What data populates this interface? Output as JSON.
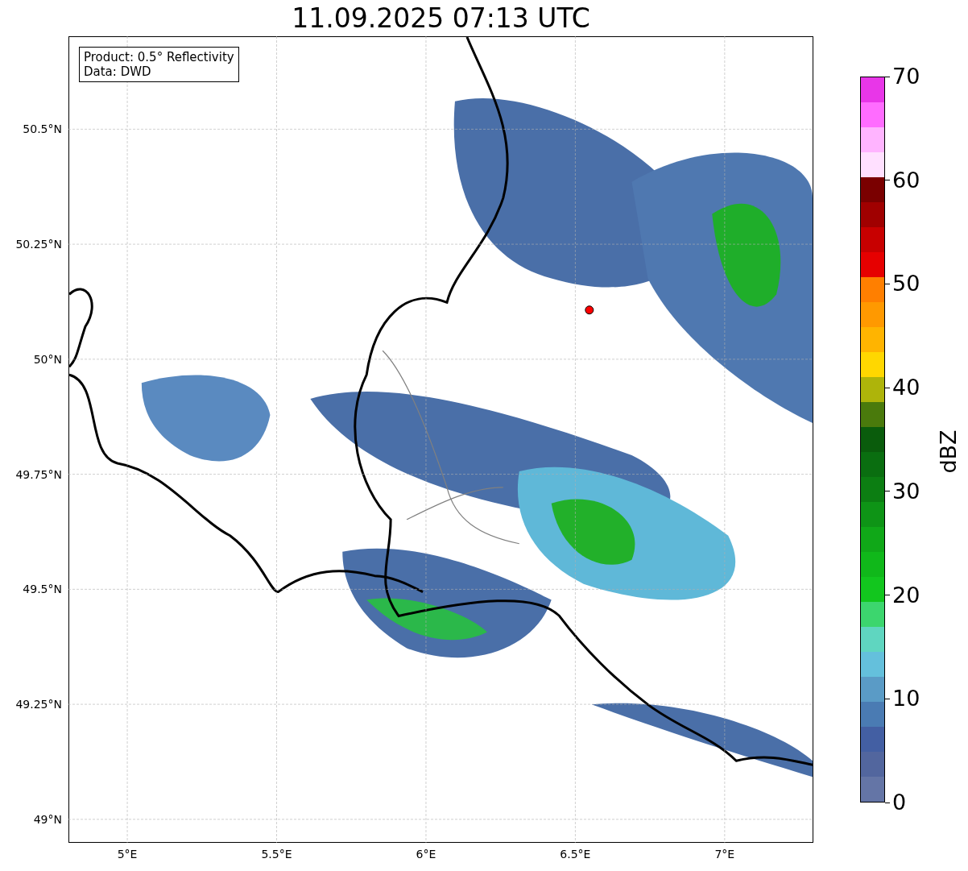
{
  "title": "11.09.2025 07:13 UTC",
  "annotation": [
    "Product: 0.5° Reflectivity",
    "Data: DWD"
  ],
  "map": {
    "chart_data": {
      "type": "scatter",
      "grid": true,
      "xlim": [
        4.803,
        7.297
      ],
      "ylim": [
        48.949,
        50.702
      ],
      "xticks": [
        {
          "value": 5,
          "label": "5°E"
        },
        {
          "value": 5.5,
          "label": "5.5°E"
        },
        {
          "value": 6,
          "label": "6°E"
        },
        {
          "value": 6.5,
          "label": "6.5°E"
        },
        {
          "value": 7,
          "label": "7°E"
        }
      ],
      "yticks": [
        {
          "value": 49,
          "label": "49°N"
        },
        {
          "value": 49.25,
          "label": "49.25°N"
        },
        {
          "value": 49.5,
          "label": "49.5°N"
        },
        {
          "value": 49.75,
          "label": "49.75°N"
        },
        {
          "value": 50,
          "label": "50°N"
        },
        {
          "value": 50.25,
          "label": "50.25°N"
        },
        {
          "value": 50.5,
          "label": "50.5°N"
        }
      ],
      "x": [
        6.547
      ],
      "series": [
        {
          "color": "#ff0000",
          "values": [
            50.107
          ]
        }
      ]
    }
  },
  "colorbar": {
    "label": "dBZ",
    "segments": [
      {
        "color": "#e836e8"
      },
      {
        "color": "#ff6cff"
      },
      {
        "color": "#ffb4ff"
      },
      {
        "color": "#ffe0ff"
      },
      {
        "color": "#7a0000"
      },
      {
        "color": "#a00000"
      },
      {
        "color": "#c80000"
      },
      {
        "color": "#e60000"
      },
      {
        "color": "#ff7f00"
      },
      {
        "color": "#ff9900"
      },
      {
        "color": "#ffb400"
      },
      {
        "color": "#ffd700"
      },
      {
        "color": "#aeb40a"
      },
      {
        "color": "#4a7a0c"
      },
      {
        "color": "#0a5c0c"
      },
      {
        "color": "#0a6e10"
      },
      {
        "color": "#0c7e12"
      },
      {
        "color": "#0e9416"
      },
      {
        "color": "#10a818"
      },
      {
        "color": "#10b81a"
      },
      {
        "color": "#12c61e"
      },
      {
        "color": "#3cd66e"
      },
      {
        "color": "#5fd6c0"
      },
      {
        "color": "#64c0dc"
      },
      {
        "color": "#5a9bc6"
      },
      {
        "color": "#4a7bb3"
      },
      {
        "color": "#435fa3"
      },
      {
        "color": "#52669e"
      },
      {
        "color": "#6475a6"
      }
    ],
    "ticks": [
      "70",
      "60",
      "50",
      "40",
      "30",
      "20",
      "10",
      "0"
    ]
  }
}
